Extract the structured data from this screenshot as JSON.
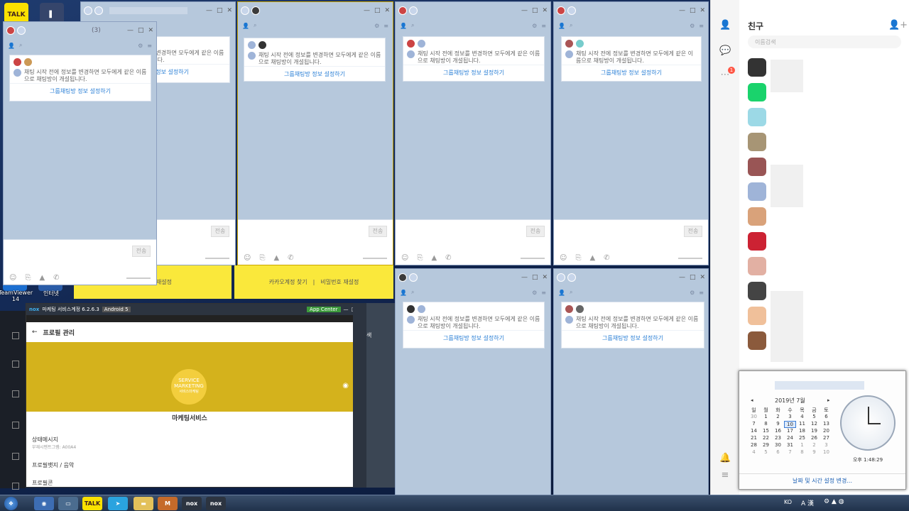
{
  "desktop_icons": [
    {
      "label": "TeamViewer 14"
    },
    {
      "label": "인터넷"
    }
  ],
  "chat": {
    "notice": "채팅 시작 전에 정보를 변경하면 모두에게 같은 이름으로 채팅방이 개설됩니다.",
    "setup_link": "그룹채팅방 정보 설정하기",
    "send_label": "전송",
    "count": "(3)"
  },
  "yellow": {
    "find": "카카오계정 찾기",
    "reset": "비밀번호 재설정"
  },
  "friends": {
    "title": "친구",
    "search_placeholder": "이름검색",
    "badge": "1"
  },
  "nox": {
    "title": "마케팅 서비스계정 6.2.6.3",
    "android": "Android 5",
    "app_center": "App Center",
    "header": "프로필 관리",
    "logo_line1": "SERVICE",
    "logo_line2": "MARKETING",
    "logo_line3": "서비스마케팅",
    "name": "마케팅서비스",
    "status_label": "상태메시지",
    "status_value": "부재시멘트그램: A00A4",
    "menu1": "프로필뱃지 / 음악",
    "menu2": "프로필콘",
    "search_frag": "색"
  },
  "calendar": {
    "month": "2019년 7월",
    "weekdays": [
      "일",
      "월",
      "화",
      "수",
      "목",
      "금",
      "토"
    ],
    "rows": [
      [
        "30",
        "1",
        "2",
        "3",
        "4",
        "5",
        "6"
      ],
      [
        "7",
        "8",
        "9",
        "10",
        "11",
        "12",
        "13"
      ],
      [
        "14",
        "15",
        "16",
        "17",
        "18",
        "19",
        "20"
      ],
      [
        "21",
        "22",
        "23",
        "24",
        "25",
        "26",
        "27"
      ],
      [
        "28",
        "29",
        "30",
        "31",
        "1",
        "2",
        "3"
      ],
      [
        "4",
        "5",
        "6",
        "7",
        "8",
        "9",
        "10"
      ]
    ],
    "today": "10",
    "time": "오후 1:48:29",
    "change_link": "날짜 및 시간 설정 변경..."
  },
  "taskbar": {
    "lang": "KO"
  }
}
